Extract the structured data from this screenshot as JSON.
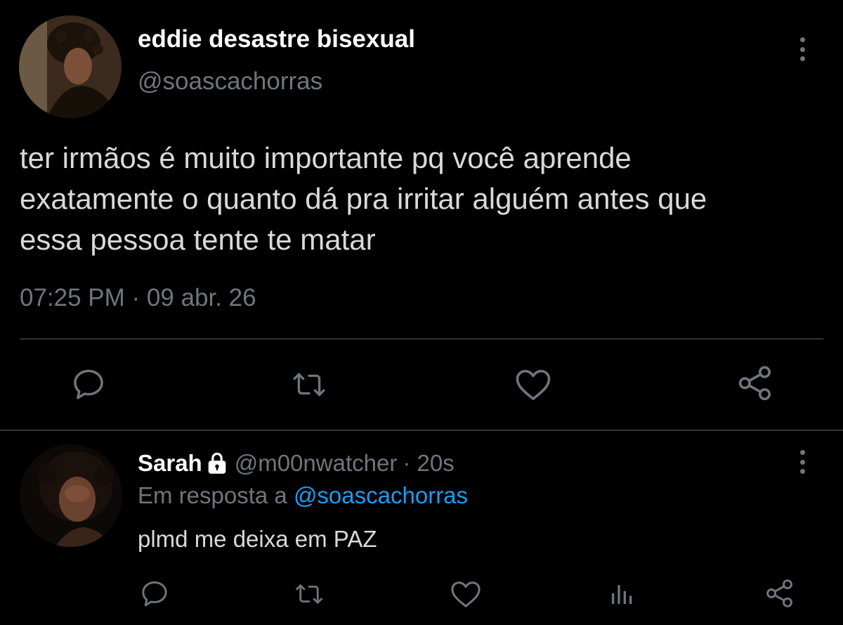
{
  "tweet": {
    "author": {
      "display_name": "eddie desastre bisexual",
      "handle": "@soascachorras",
      "avatar_icon": "user-avatar-photo"
    },
    "text_lines": [
      "ter irmãos é muito importante pq você aprende",
      "exatamente o quanto dá pra irritar alguém antes que",
      "essa pessoa tente te matar"
    ],
    "timestamp": "07:25 PM · 09 abr. 26",
    "actions": [
      "reply-icon",
      "retweet-icon",
      "like-icon",
      "share-icon"
    ]
  },
  "reply": {
    "author": {
      "display_name": "Sarah",
      "handle": "@m00nwatcher",
      "time_ago": "· 20s",
      "protected_icon": "lock-icon",
      "avatar_icon": "user-avatar-photo"
    },
    "context_prefix": "Em resposta a",
    "context_mention": "@soascachorras",
    "text": "plmd me deixa em PAZ",
    "actions": [
      "reply-icon",
      "retweet-icon",
      "like-icon",
      "analytics-icon",
      "share-icon"
    ]
  },
  "colors": {
    "background": "#000000",
    "primary_text": "#d9d9d9",
    "name_text": "#ffffff",
    "secondary_text": "#6e767d",
    "link": "#1d9bf0",
    "divider": "#2f3336",
    "icon": "#6e767d"
  }
}
